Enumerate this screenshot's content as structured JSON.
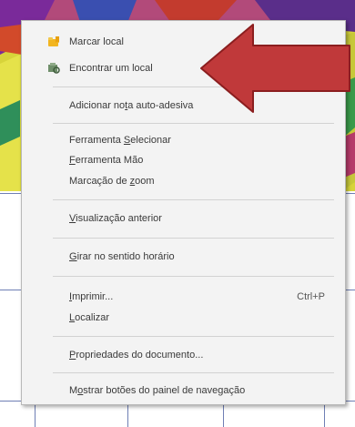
{
  "menu": {
    "items": [
      {
        "id": "marcar-local",
        "pre": "",
        "ul": "",
        "post": "Marcar local",
        "shortcut": "",
        "icon": "bookmark-folder-icon"
      },
      {
        "id": "encontrar-local",
        "pre": "",
        "ul": "",
        "post": "Encontrar um local",
        "shortcut": "",
        "icon": "find-location-icon"
      },
      {
        "id": "adicionar-nota",
        "pre": "Adicionar no",
        "ul": "t",
        "post": "a auto-adesiva",
        "shortcut": "",
        "icon": ""
      },
      {
        "id": "ferramenta-selecionar",
        "pre": "Ferramenta ",
        "ul": "S",
        "post": "elecionar",
        "shortcut": "",
        "icon": ""
      },
      {
        "id": "ferramenta-mao",
        "pre": "",
        "ul": "F",
        "post": "erramenta Mão",
        "shortcut": "",
        "icon": ""
      },
      {
        "id": "marcacao-zoom",
        "pre": "Marcação de ",
        "ul": "z",
        "post": "oom",
        "shortcut": "",
        "icon": ""
      },
      {
        "id": "visualizacao-anterior",
        "pre": "",
        "ul": "V",
        "post": "isualização anterior",
        "shortcut": "",
        "icon": ""
      },
      {
        "id": "girar-horario",
        "pre": "",
        "ul": "G",
        "post": "irar no sentido horário",
        "shortcut": "",
        "icon": ""
      },
      {
        "id": "imprimir",
        "pre": "",
        "ul": "I",
        "post": "mprimir...",
        "shortcut": "Ctrl+P",
        "icon": ""
      },
      {
        "id": "localizar",
        "pre": "",
        "ul": "L",
        "post": "ocalizar",
        "shortcut": "",
        "icon": ""
      },
      {
        "id": "propriedades-documento",
        "pre": "",
        "ul": "P",
        "post": "ropriedades do documento...",
        "shortcut": "",
        "icon": ""
      },
      {
        "id": "mostrar-botoes",
        "pre": "M",
        "ul": "o",
        "post": "strar botões do painel de navegação",
        "shortcut": "",
        "icon": ""
      }
    ]
  },
  "colors": {
    "menu_bg": "#f3f3f3",
    "separator": "#d2d2d2",
    "arrow_fill": "#c0393a",
    "arrow_stroke": "#8b1e1f",
    "grid": "#6f7fb5"
  }
}
